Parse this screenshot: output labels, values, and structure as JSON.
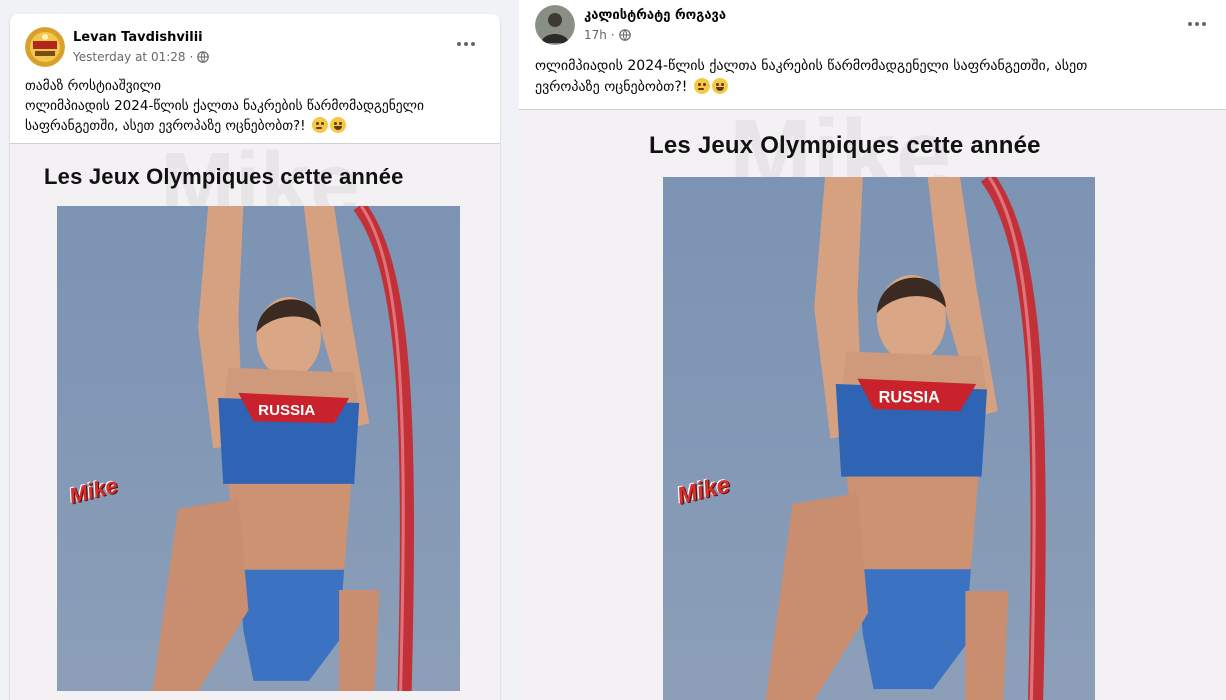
{
  "colors": {
    "page_bg": "#f0f2f5",
    "card_bg": "#ffffff",
    "meta_gray": "#65676b",
    "pole_red": "#c23038",
    "uniform_blue": "#2f63b3",
    "uniform_red": "#c9222c"
  },
  "posts": [
    {
      "author": "Levan Tavdishvilii",
      "timestamp": "Yesterday at 01:28",
      "privacy_icon": "globe-icon",
      "more_icon": "more-options-icon",
      "text_lines": [
        "თამაზ როსტიაშვილი",
        "ოლიმპიადის 2024-წლის ქალთა ნაკრების წარმომადგენელი",
        "საფრანგეთში, ასეთ ევროპაზე ოცნებობთ?!"
      ],
      "emojis": [
        "thinking-face-emoji",
        "grinning-face-emoji"
      ],
      "image": {
        "caption": "Les Jeux Olympiques cette année",
        "watermark": "Mike",
        "stamp": "Mike",
        "jersey_text": "RUSSIA"
      }
    },
    {
      "author": "კალისტრატე როგავა",
      "timestamp": "17h",
      "privacy_icon": "globe-icon",
      "more_icon": "more-options-icon",
      "text_lines": [
        "ოლიმპიადის 2024-წლის ქალთა ნაკრების წარმომადგენელი საფრანგეთში, ასეთ",
        "ევროპაზე ოცნებობთ?!"
      ],
      "emojis": [
        "thinking-face-emoji",
        "grinning-face-emoji"
      ],
      "image": {
        "caption": "Les Jeux Olympiques cette année",
        "watermark": "Mike",
        "stamp": "Mike",
        "jersey_text": "RUSSIA"
      }
    }
  ]
}
